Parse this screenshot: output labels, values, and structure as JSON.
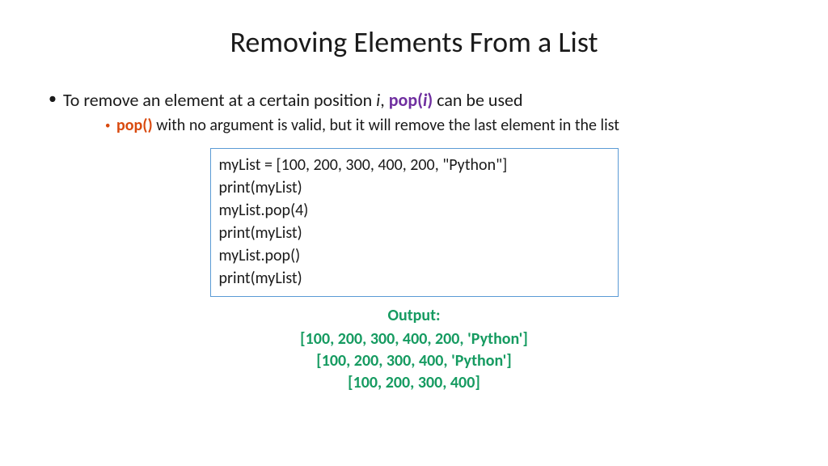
{
  "title": "Removing Elements From a List",
  "bullet1": {
    "pre": "To remove an element at a certain position ",
    "i1": "i",
    "mid": ", ",
    "pop_open": "pop(",
    "pop_arg": "i",
    "pop_close": ")",
    "post": " can be used"
  },
  "bullet2": {
    "pop_noargs": "pop()",
    "rest": " with no argument is valid, but it will remove the last element in the list"
  },
  "code": {
    "l1": "myList = [100, 200, 300, 400, 200, \"Python\"]",
    "l2": "print(myList)",
    "l3": "myList.pop(4)",
    "l4": "print(myList)",
    "l5": "myList.pop()",
    "l6": "print(myList)"
  },
  "output": {
    "label": "Output:",
    "line1": "[100, 200, 300, 400, 200, 'Python']",
    "line2": "[100, 200, 300, 400, 'Python']",
    "line3": "[100, 200, 300, 400]"
  }
}
